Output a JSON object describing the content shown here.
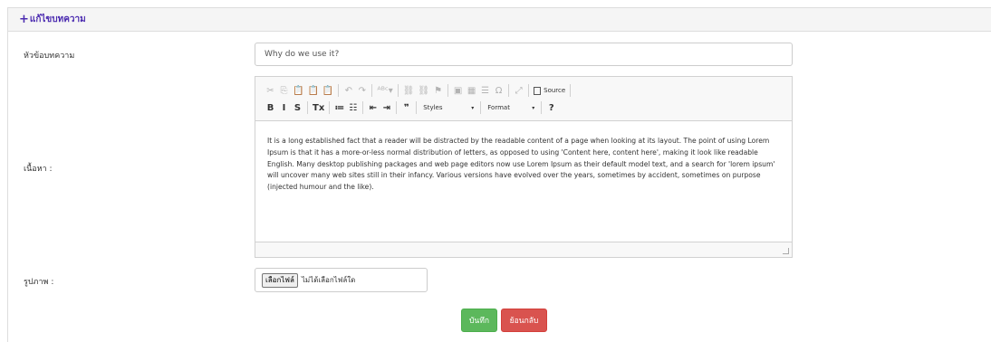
{
  "panel": {
    "plus_icon": "+",
    "title": "แก้ไขบทความ"
  },
  "form": {
    "title_label": "หัวข้อบทความ",
    "title_value": "Why do we use it?",
    "content_label": "เนื้อหา :",
    "image_label": "รูปภาพ :",
    "file_button": "เลือกไฟล์",
    "file_status": "ไม่ได้เลือกไฟล์ใด"
  },
  "editor": {
    "toolbar_row1": [
      {
        "icon": "cut-icon",
        "glyph": "✂"
      },
      {
        "icon": "copy-icon",
        "glyph": "⎘"
      },
      {
        "icon": "paste-icon",
        "glyph": "📋"
      },
      {
        "icon": "paste-text-icon",
        "glyph": "📋"
      },
      {
        "icon": "paste-word-icon",
        "glyph": "📋"
      },
      {
        "sep": true
      },
      {
        "icon": "undo-icon",
        "glyph": "↶"
      },
      {
        "icon": "redo-icon",
        "glyph": "↷"
      },
      {
        "sep": true
      },
      {
        "icon": "spellcheck-icon",
        "glyph": "ᴬᴮᶜ▾"
      },
      {
        "sep": true
      },
      {
        "icon": "link-icon",
        "glyph": "⛓"
      },
      {
        "icon": "unlink-icon",
        "glyph": "⛓"
      },
      {
        "icon": "anchor-icon",
        "glyph": "⚑"
      },
      {
        "sep": true
      },
      {
        "icon": "image-icon",
        "glyph": "▣"
      },
      {
        "icon": "table-icon",
        "glyph": "▦"
      },
      {
        "icon": "horizontal-line-icon",
        "glyph": "☰"
      },
      {
        "icon": "special-char-icon",
        "glyph": "Ω"
      },
      {
        "sep": true
      },
      {
        "icon": "maximize-icon",
        "glyph": "⤢"
      },
      {
        "sep": true
      }
    ],
    "source_label": "Source",
    "toolbar_row2": [
      {
        "icon": "bold-icon",
        "glyph": "B"
      },
      {
        "icon": "italic-icon",
        "glyph": "I"
      },
      {
        "icon": "strike-icon",
        "glyph": "S"
      },
      {
        "sep": true
      },
      {
        "icon": "remove-format-icon",
        "glyph": "Tx"
      },
      {
        "sep": true
      },
      {
        "icon": "numbered-list-icon",
        "glyph": "≔"
      },
      {
        "icon": "bulleted-list-icon",
        "glyph": "☷"
      },
      {
        "sep": true
      },
      {
        "icon": "outdent-icon",
        "glyph": "⇤"
      },
      {
        "icon": "indent-icon",
        "glyph": "⇥"
      },
      {
        "sep": true
      },
      {
        "icon": "blockquote-icon",
        "glyph": "❞"
      },
      {
        "sep": true
      }
    ],
    "styles_label": "Styles",
    "format_label": "Format",
    "help_glyph": "?",
    "content": "It is a long established fact that a reader will be distracted by the readable content of a page when looking at its layout. The point of using Lorem Ipsum is that it has a more-or-less normal distribution of letters, as opposed to using 'Content here, content here', making it look like readable English. Many desktop publishing packages and web page editors now use Lorem Ipsum as their default model text, and a search for 'lorem ipsum' will uncover many web sites still in their infancy. Various versions have evolved over the years, sometimes by accident, sometimes on purpose (injected humour and the like)."
  },
  "buttons": {
    "save": "บันทึก",
    "back": "ย้อนกลับ"
  },
  "colors": {
    "heading_text": "#4b2bb0",
    "save_bg": "#5cb85c",
    "back_bg": "#d9534f"
  }
}
